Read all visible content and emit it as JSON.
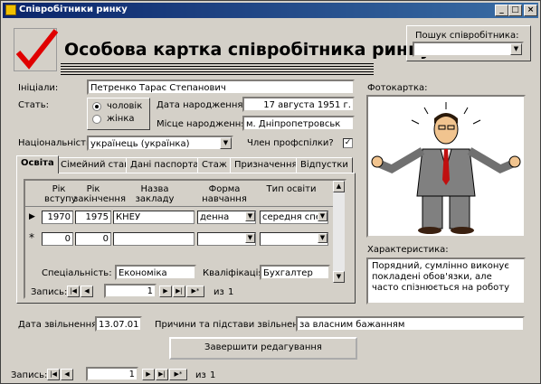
{
  "window": {
    "title": "Співробітники ринку"
  },
  "header": {
    "title": "Особова картка співробітника ринку"
  },
  "search": {
    "label": "Пошук співробітника:",
    "value": ""
  },
  "fields": {
    "initials_label": "Ініціали:",
    "initials_value": "Петренко Тарас Степанович",
    "gender_label": "Стать:",
    "gender_male": "чоловік",
    "gender_female": "жінка",
    "birth_date_label": "Дата народження:",
    "birth_date_value": "17 августа 1951 г.",
    "birth_place_label": "Місце народження:",
    "birth_place_value": "м. Дніпропетровськ",
    "nationality_label": "Національність",
    "nationality_value": "українець (українка)",
    "union_label": "Член профспілки?",
    "union_checked": "✓",
    "photo_label": "Фотокартка:",
    "characteristic_label": "Характеристика:",
    "characteristic_value": "Порядний, сумлінно виконує покладені обов'язки, але часто спізнюється на роботу"
  },
  "tabs": [
    "Освіта",
    "Сімейний стан",
    "Дані паспорта",
    "Стаж",
    "Призначення",
    "Відпустки"
  ],
  "education": {
    "headers": {
      "start_year": "Рік вступу",
      "end_year": "Рік закінчення",
      "institution": "Назва закладу",
      "study_form": "Форма навчання",
      "edu_type": "Тип освіти"
    },
    "rows": [
      {
        "start_year": "1970",
        "end_year": "1975",
        "institution": "КНЕУ",
        "study_form": "денна",
        "edu_type": "середня спе"
      },
      {
        "start_year": "0",
        "end_year": "0",
        "institution": "",
        "study_form": "",
        "edu_type": ""
      }
    ],
    "speciality_label": "Спеціальність:",
    "speciality_value": "Економіка",
    "qualification_label": "Кваліфікація:",
    "qualification_value": "Бухгалтер",
    "record_label": "Запись:",
    "record_value": "1",
    "record_of": "из",
    "record_total": "1"
  },
  "footer": {
    "dismissal_date_label": "Дата звільнення:",
    "dismissal_date_value": "13.07.01",
    "dismissal_reason_label": "Причини та підстави звільнення:",
    "dismissal_reason_value": "за власним бажанням",
    "finish_button": "Завершити редагування",
    "record_label": "Запись:",
    "record_value": "1",
    "record_of": "из",
    "record_total": "1"
  },
  "colors": {
    "title_bar": "#0a246a",
    "check_mark": "#e00000",
    "face": "#d4d0c8"
  }
}
